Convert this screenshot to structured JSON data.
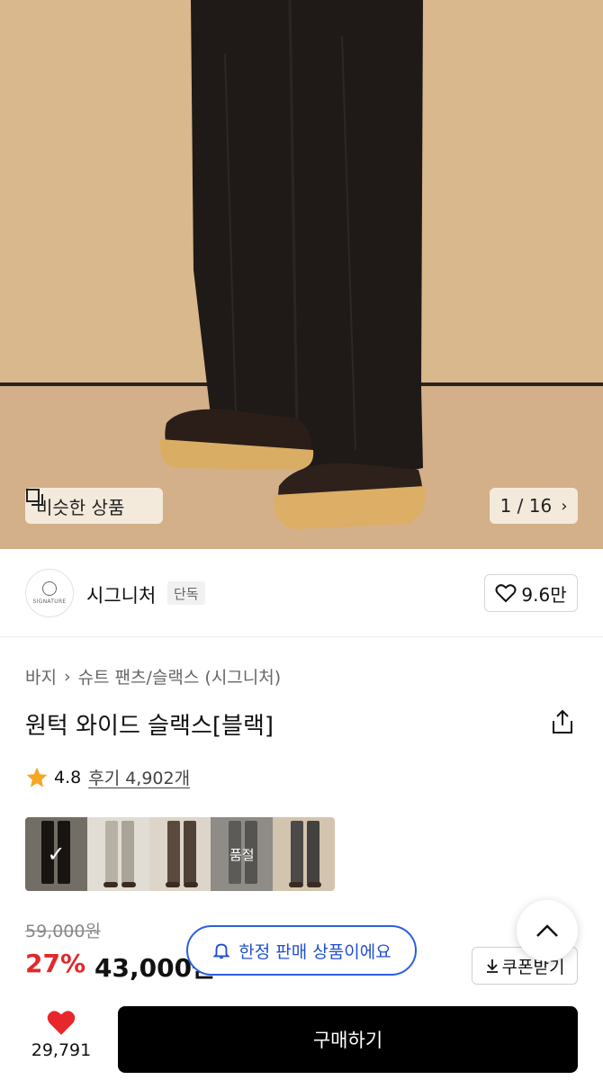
{
  "hero": {
    "similar_label": "비슷한 상품",
    "counter": "1 / 16"
  },
  "brand": {
    "logo_text": "SIGNATURE",
    "name": "시그니처",
    "badge": "단독",
    "likes": "9.6만"
  },
  "breadcrumb": {
    "category": "바지",
    "subcategory": "슈트 팬츠/슬랙스 (시그니처)"
  },
  "product": {
    "title": "원턱 와이드 슬랙스[블랙]",
    "rating": "4.8",
    "reviews": "후기 4,902개"
  },
  "swatches": [
    {
      "name": "black",
      "selected": true,
      "sold_out": false,
      "color": "#2a2622"
    },
    {
      "name": "beige",
      "selected": false,
      "sold_out": false,
      "color": "#b7b0a4"
    },
    {
      "name": "brown",
      "selected": false,
      "sold_out": false,
      "color": "#5a4a3e"
    },
    {
      "name": "gray",
      "selected": false,
      "sold_out": true,
      "color": "#8f8c88",
      "label": "품절"
    },
    {
      "name": "charcoal",
      "selected": false,
      "sold_out": false,
      "color": "#4b4a48"
    }
  ],
  "price": {
    "original": "59,000원",
    "discount": "27%",
    "sale": "43,000원",
    "coupon_label": "쿠폰받기"
  },
  "toast": {
    "text": "한정 판매 상품이에요"
  },
  "bottom": {
    "wish_count": "29,791",
    "buy_label": "구매하기"
  },
  "colors": {
    "discount": "#e0292b",
    "toast_blue": "#2b5fe0",
    "wish_red": "#e8272c",
    "buy_bg": "#000000"
  }
}
